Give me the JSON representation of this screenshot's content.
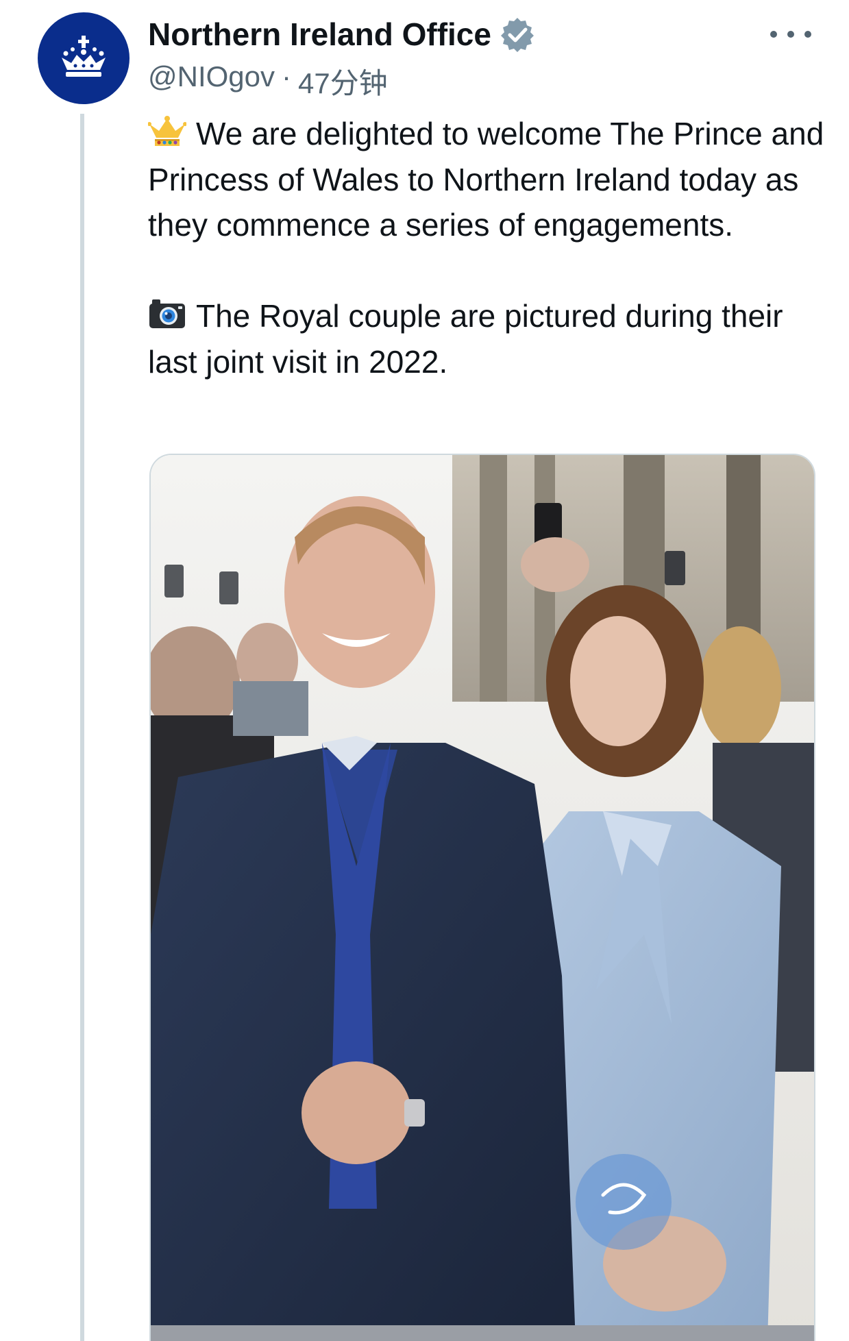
{
  "account": {
    "display_name": "Northern Ireland Office",
    "handle": "@NIOgov",
    "separator": "·",
    "timestamp": "47分钟",
    "verified": true,
    "avatar_icon": "crown-icon",
    "avatar_color": "#0a2d8c",
    "verified_color": "#829aab"
  },
  "tweet": {
    "paragraph1_emoji": "crown-emoji",
    "paragraph1_text": "We are delighted to welcome The Prince and Princess of Wales to Northern Ireland today as they commence a series of engagements.",
    "paragraph2_emoji": "camera-emoji",
    "paragraph2_text": "The Royal couple are pictured during their last joint visit in 2022."
  },
  "media": {
    "type": "photo",
    "icon": "photo-royal-couple"
  },
  "actions": {
    "more_icon": "more-options-icon"
  },
  "colors": {
    "text_primary": "#0f1419",
    "text_secondary": "#536471",
    "border": "#cfd9de"
  }
}
